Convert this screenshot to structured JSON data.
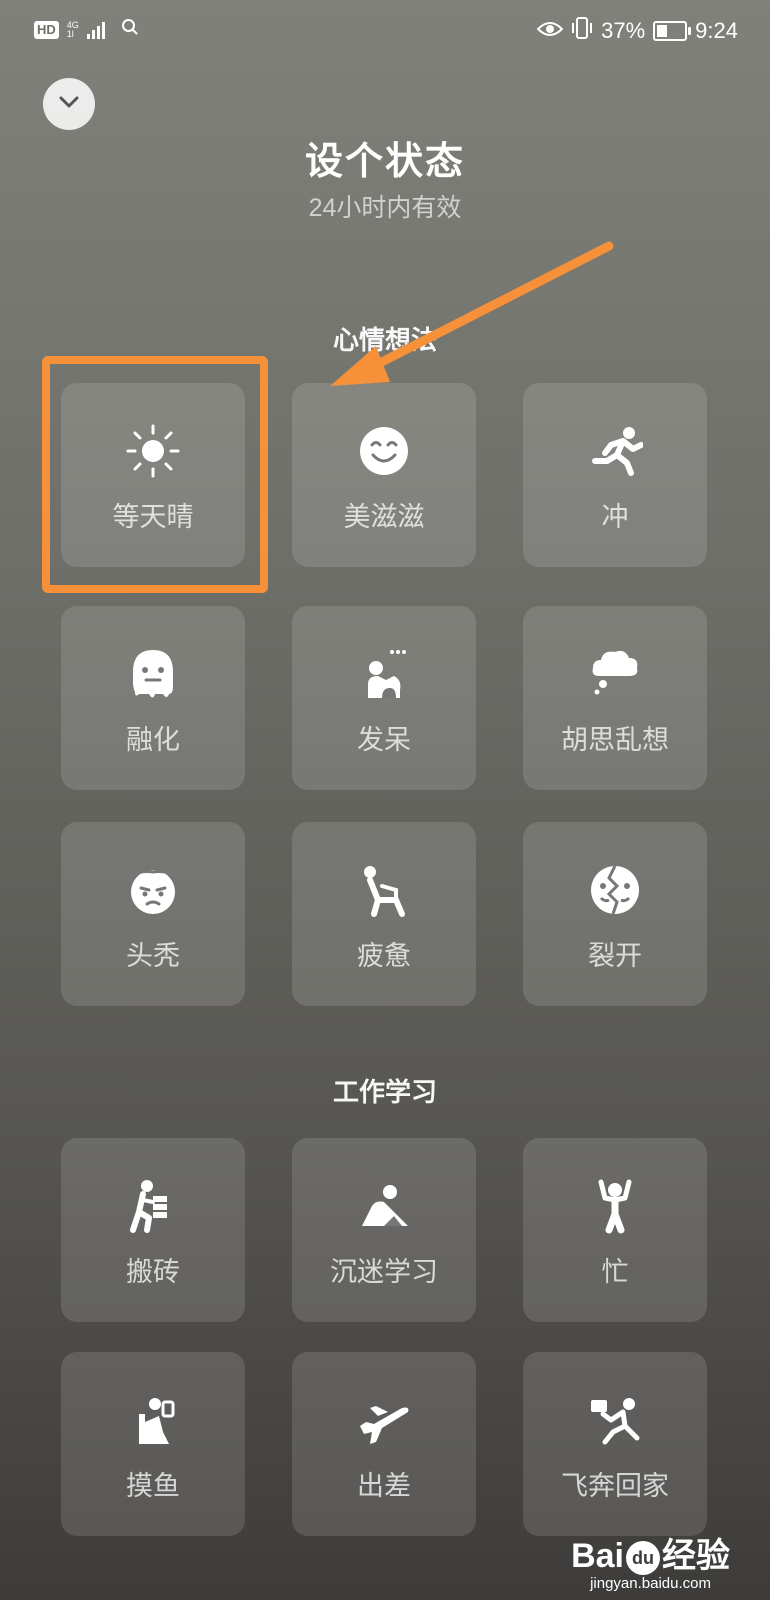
{
  "status_bar": {
    "hd": "HD",
    "network": "4G",
    "network_sub": "1l",
    "battery": "37%",
    "time": "9:24",
    "battery_level": 0.37
  },
  "header": {
    "title": "设个状态",
    "subtitle": "24小时内有效"
  },
  "sections": [
    {
      "title": "心情想法",
      "items": [
        {
          "label": "等天晴",
          "icon": "sun-icon"
        },
        {
          "label": "美滋滋",
          "icon": "smile-icon"
        },
        {
          "label": "冲",
          "icon": "running-icon"
        },
        {
          "label": "融化",
          "icon": "melting-icon"
        },
        {
          "label": "发呆",
          "icon": "daze-icon"
        },
        {
          "label": "胡思乱想",
          "icon": "thought-cloud-icon"
        },
        {
          "label": "头秃",
          "icon": "bald-head-icon"
        },
        {
          "label": "疲惫",
          "icon": "tired-icon"
        },
        {
          "label": "裂开",
          "icon": "cracked-face-icon"
        }
      ]
    },
    {
      "title": "工作学习",
      "items": [
        {
          "label": "搬砖",
          "icon": "carrying-bricks-icon"
        },
        {
          "label": "沉迷学习",
          "icon": "studying-icon"
        },
        {
          "label": "忙",
          "icon": "busy-icon"
        },
        {
          "label": "摸鱼",
          "icon": "slacking-icon"
        },
        {
          "label": "出差",
          "icon": "airplane-icon"
        },
        {
          "label": "飞奔回家",
          "icon": "rushing-home-icon"
        }
      ]
    }
  ],
  "annotation": {
    "highlight_color": "#f6913a"
  },
  "watermark": {
    "logo_a": "Bai",
    "logo_paw": "du",
    "logo_b": "经验",
    "url": "jingyan.baidu.com"
  }
}
